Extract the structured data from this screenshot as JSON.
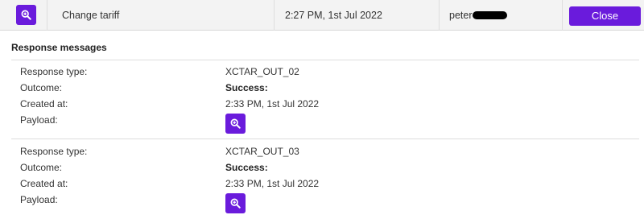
{
  "top_row": {
    "view_icon": "zoom-in-icon",
    "action": "Change tariff",
    "timestamp": "2:27 PM, 1st Jul 2022",
    "user": "peter",
    "close_label": "Close"
  },
  "response_section": {
    "title": "Response messages",
    "labels": {
      "response_type": "Response type:",
      "outcome": "Outcome:",
      "created_at": "Created at:",
      "payload": "Payload:"
    },
    "items": [
      {
        "response_type": "XCTAR_OUT_02",
        "outcome": "Success:",
        "created_at": "2:33 PM, 1st Jul 2022",
        "payload_icon": "zoom-in-icon"
      },
      {
        "response_type": "XCTAR_OUT_03",
        "outcome": "Success:",
        "created_at": "2:33 PM, 1st Jul 2022",
        "payload_icon": "zoom-in-icon"
      }
    ]
  },
  "colors": {
    "accent": "#6a1bdc",
    "row_background": "#f3f3f3",
    "divider": "#dddddd"
  }
}
